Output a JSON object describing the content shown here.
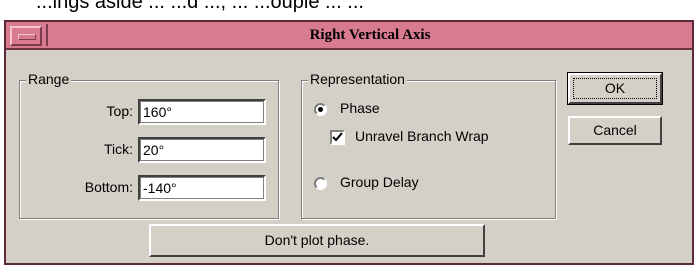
{
  "background_text": "...ings aside ... ...d ..., ... ...ouple ... ...",
  "window": {
    "title": "Right Vertical Axis"
  },
  "range": {
    "legend": "Range",
    "top_label": "Top:",
    "top_value": "160°",
    "tick_label": "Tick:",
    "tick_value": "20°",
    "bottom_label": "Bottom:",
    "bottom_value": "-140°"
  },
  "representation": {
    "legend": "Representation",
    "phase_label": "Phase",
    "phase_selected": true,
    "unravel_label": "Unravel Branch Wrap",
    "unravel_checked": true,
    "group_delay_label": "Group Delay",
    "group_delay_selected": false
  },
  "buttons": {
    "ok_label": "OK",
    "cancel_label": "Cancel",
    "dont_plot_label": "Don't plot phase."
  },
  "colors": {
    "titlebar": "#d87a90",
    "dialog_face": "#d4d0c8"
  },
  "icons": {
    "window_menu": "window-menu-icon",
    "checkmark": "checkmark-icon",
    "radio_dot": "radio-dot-icon"
  }
}
